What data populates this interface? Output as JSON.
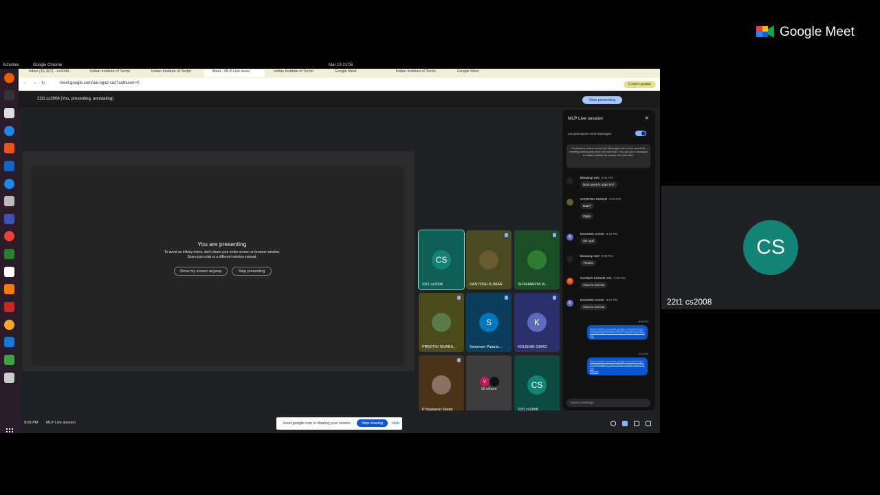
{
  "right": {
    "brand": "Google Meet",
    "avatar_initials": "CS",
    "name": "22t1 cs2008"
  },
  "gnome": {
    "activities": "Activities",
    "app": "Google Chrome",
    "clock": "Mar 19  21:05"
  },
  "tabs": [
    {
      "label": "Inbox (15,307) - cs2008..."
    },
    {
      "label": "Indian Institute of Techn"
    },
    {
      "label": "Indian Institute of Techn"
    },
    {
      "label": "Meet - MLP Live sessi",
      "active": true
    },
    {
      "label": "Indian Institute of Techn"
    },
    {
      "label": "Google Meet"
    },
    {
      "label": "Indian Institute of Techn"
    },
    {
      "label": "Google Meet"
    }
  ],
  "url": "meet.google.com/aai-ngaz-cuz?authuser=0",
  "finish_update": "Finish update",
  "topbar": {
    "presenting_info": "22t1 cs2008 (You, presenting, annotating)",
    "stop_presenting": "Stop presenting"
  },
  "presenting": {
    "title": "You are presenting",
    "warning_line1": "To avoid an infinity mirror, don't share your entire screen or browser window.",
    "warning_line2": "Share just a tab or a different window instead.",
    "show_btn": "Show my screen anyway",
    "stop_btn": "Stop presenting"
  },
  "tiles": [
    {
      "name": "22t1 cs2008",
      "initials": "CS",
      "bg": "#0f5e55",
      "av": "#128374",
      "selected": true
    },
    {
      "name": "SANTOSH KUMAR",
      "initials": "",
      "bg": "#4a4a22",
      "av": "#6a5a30",
      "mic": true
    },
    {
      "name": "SHYAMANTA M...",
      "initials": "",
      "bg": "#1b4d26",
      "av": "#2e7d32",
      "mic": true
    },
    {
      "name": "PREETHI SIVARA...",
      "initials": "",
      "bg": "#4a4a1a",
      "av": "#5a7a4a",
      "mic": true
    },
    {
      "name": "Swarnam Palanis...",
      "initials": "S",
      "bg": "#0b3d5c",
      "av": "#0277bd",
      "mic": true
    },
    {
      "name": "KOUSHIK GARG",
      "initials": "K",
      "bg": "#2b2f6b",
      "av": "#5c6bc0",
      "mic": true
    },
    {
      "name": "P Baskaran Nadar",
      "initials": "",
      "bg": "#4a3318",
      "av": "#8d6e63",
      "mic": true
    },
    {
      "name": "10 others",
      "initials": "V",
      "bg": "#3c3c3c",
      "av": "#c2185b"
    },
    {
      "name": "22t1 cs2008",
      "initials": "CS",
      "bg": "#0f4a42",
      "av": "#128374"
    }
  ],
  "chat": {
    "title": "MLP Live session",
    "allow_label": "Let participants send messages",
    "notice": "Continuous chat is turned off. Messages will not be saved for meeting participants when the call ends. You can pin a message to make it visible for people who join later.",
    "messages": [
      {
        "who": "Biswarup Sett",
        "time": "8:02 PM",
        "initial": "",
        "color": "#222",
        "texts": [
          "Next week is oppe tm?"
        ]
      },
      {
        "who": "SANTOSH KUMAR",
        "time": "8:02 PM",
        "initial": "",
        "color": "#6a5a30",
        "texts": [
          "Date?",
          "Oppe"
        ]
      },
      {
        "who": "KOUSHIK GARG",
        "time": "8:04 PM",
        "initial": "K",
        "color": "#5c6bc0",
        "texts": [
          "4th April"
        ]
      },
      {
        "who": "Biswarup Sett",
        "time": "8:05 PM",
        "initial": "",
        "color": "#222",
        "texts": [
          "Thanks"
        ]
      },
      {
        "who": "GAURAV KUMAR JHA",
        "time": "8:05 PM",
        "initial": "G",
        "color": "#e65100",
        "texts": [
          "Voice is too low"
        ]
      },
      {
        "who": "KOUSHIK GARG",
        "time": "8:07 PM",
        "initial": "K",
        "color": "#5c6bc0",
        "texts": [
          "Voice is too low"
        ]
      }
    ],
    "mine": [
      {
        "time": "8:09 PM",
        "text": "https://colab.research.google.com/drive/1gX9vm6W52gE2f7R5h-G9VyT-cwn6t7usp=sharing"
      },
      {
        "time": "9:04 PM",
        "text": "https://colab.research.google.com/drive/1gX9vm6W52gE2f7R5h-G9VyT-cwn6t7usp=sharing",
        "pinned": "Pinned"
      }
    ],
    "send_placeholder": "Send a message"
  },
  "bottom": {
    "time": "9:05 PM",
    "meeting": "MLP Live session",
    "share_text": "meet.google.com is sharing your screen.",
    "stop_sharing": "Stop sharing",
    "hide": "Hide"
  }
}
